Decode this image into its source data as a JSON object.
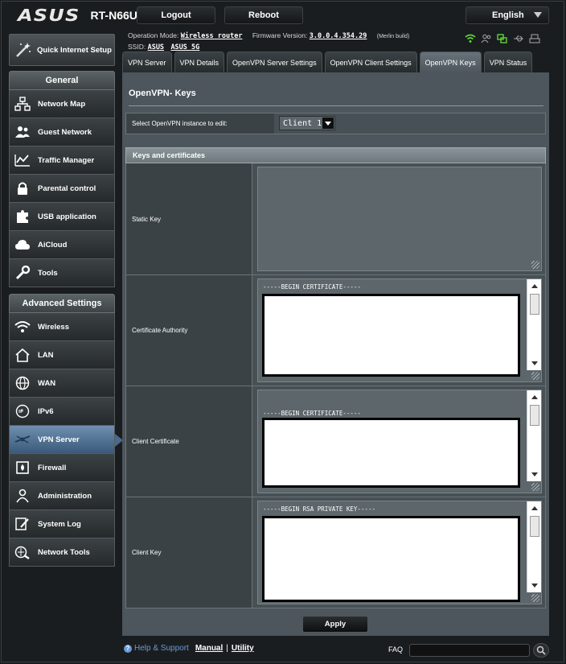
{
  "header": {
    "brand": "ASUS",
    "model": "RT-N66U",
    "logout_label": "Logout",
    "reboot_label": "Reboot",
    "language": "English",
    "op_mode_label": "Operation Mode:",
    "op_mode_value": "Wireless router",
    "firmware_label": "Firmware Version:",
    "firmware_value": "3.0.0.4.354.29",
    "build_note": "(Merlin build)",
    "ssid_label": "SSID:",
    "ssid_1": "ASUS",
    "ssid_2": "ASUS_5G"
  },
  "sidebar": {
    "quick_setup": "Quick Internet Setup",
    "general_heading": "General",
    "general_items": [
      {
        "label": "Network Map"
      },
      {
        "label": "Guest Network"
      },
      {
        "label": "Traffic Manager"
      },
      {
        "label": "Parental control"
      },
      {
        "label": "USB application"
      },
      {
        "label": "AiCloud"
      },
      {
        "label": "Tools"
      }
    ],
    "advanced_heading": "Advanced Settings",
    "advanced_items": [
      {
        "label": "Wireless"
      },
      {
        "label": "LAN"
      },
      {
        "label": "WAN"
      },
      {
        "label": "IPv6"
      },
      {
        "label": "VPN Server"
      },
      {
        "label": "Firewall"
      },
      {
        "label": "Administration"
      },
      {
        "label": "System Log"
      },
      {
        "label": "Network Tools"
      }
    ]
  },
  "tabs": [
    {
      "label": "VPN Server"
    },
    {
      "label": "VPN Details"
    },
    {
      "label": "OpenVPN Server Settings"
    },
    {
      "label": "OpenVPN Client Settings"
    },
    {
      "label": "OpenVPN Keys"
    },
    {
      "label": "VPN Status"
    }
  ],
  "main": {
    "title": "OpenVPN- Keys",
    "instance_label": "Select OpenVPN instance to edit:",
    "instance_value": "Client 1",
    "section_heading": "Keys and certificates",
    "rows": [
      {
        "label": "Static Key",
        "text": ""
      },
      {
        "label": "Certificate Authority",
        "text": "-----BEGIN CERTIFICATE-----"
      },
      {
        "label": "Client Certificate",
        "text": "-----BEGIN CERTIFICATE-----"
      },
      {
        "label": "Client Key",
        "text": "-----BEGIN RSA PRIVATE KEY-----"
      }
    ],
    "apply_label": "Apply"
  },
  "footer": {
    "help_label": "Help & Support",
    "manual_label": "Manual",
    "separator": "|",
    "utility_label": "Utility",
    "faq_label": "FAQ"
  }
}
